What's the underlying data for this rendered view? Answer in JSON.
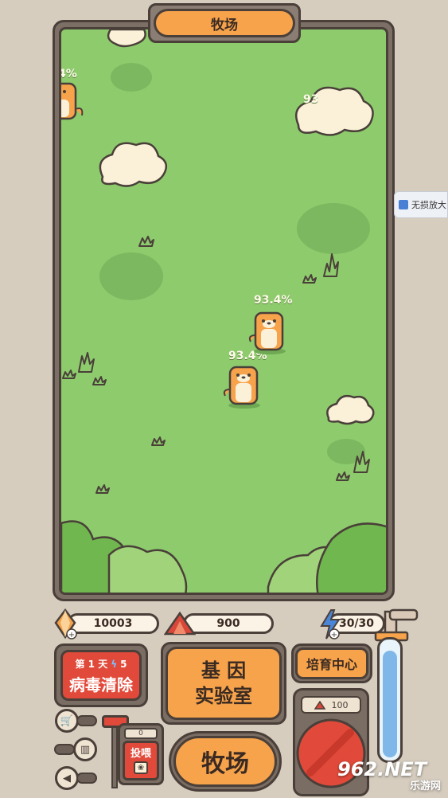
{
  "header": {
    "title": "牧场"
  },
  "field": {
    "labels": [
      {
        "text": "93.4%"
      },
      {
        "text": "93.4%"
      },
      {
        "text": "4%"
      },
      {
        "text": "93"
      }
    ]
  },
  "side_badge": {
    "label": "无损放大"
  },
  "resources": {
    "gems": "10003",
    "ore": "900",
    "energy": "30/30"
  },
  "event_panel": {
    "day": "第 1 天",
    "energy_cost": "5",
    "title": "病毒清除"
  },
  "buttons": {
    "gene_lab": "基 因\n实验室",
    "gene_lab_line1": "基 因",
    "gene_lab_line2": "实验室",
    "breeding_center": "培育中心",
    "ranch": "牧场",
    "feed": "投喂",
    "feed_count": "0",
    "machine_cost": "100"
  },
  "watermark": {
    "main": "962.NET",
    "sub": "乐游网"
  },
  "colors": {
    "field_green": "#8dcb6d",
    "accent_orange": "#f6a34b",
    "button_red": "#e14a3a",
    "outline": "#4a3f39"
  }
}
